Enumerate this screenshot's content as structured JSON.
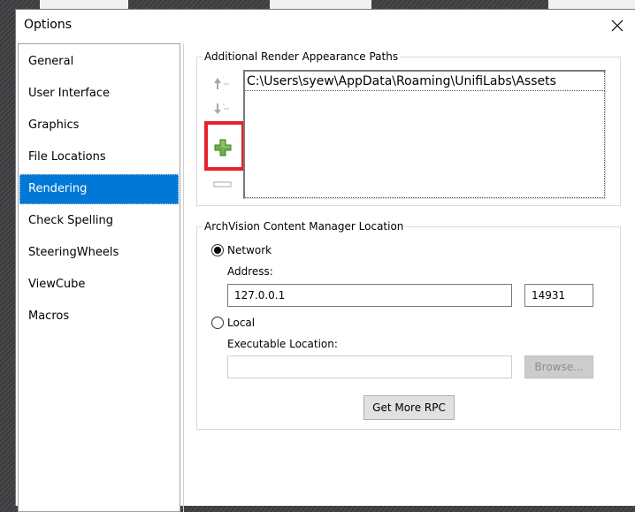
{
  "dialog": {
    "title": "Options",
    "close_label": "close"
  },
  "sidebar": {
    "items": [
      {
        "label": "General"
      },
      {
        "label": "User Interface"
      },
      {
        "label": "Graphics"
      },
      {
        "label": "File Locations"
      },
      {
        "label": "Rendering",
        "active": true
      },
      {
        "label": "Check Spelling"
      },
      {
        "label": "SteeringWheels"
      },
      {
        "label": "ViewCube"
      },
      {
        "label": "Macros"
      }
    ]
  },
  "render_paths": {
    "group_label": "Additional Render Appearance Paths",
    "paths": [
      "C:\\Users\\syew\\AppData\\Roaming\\UnifiLabs\\Assets"
    ],
    "tools": {
      "move_up": "move-up",
      "move_down": "move-down",
      "add": "add",
      "remove": "remove"
    },
    "highlight_color": "#e8202a",
    "add_icon_color": "#5a9e3c"
  },
  "archvision": {
    "group_label": "ArchVision Content Manager Location",
    "network_label": "Network",
    "network_selected": true,
    "address_label": "Address:",
    "address_value": "127.0.0.1",
    "port_value": "14931",
    "local_label": "Local",
    "local_selected": false,
    "exec_label": "Executable Location:",
    "exec_value": "",
    "browse_label": "Browse...",
    "get_more_label": "Get More RPC"
  },
  "colors": {
    "accent": "#0078d7"
  }
}
